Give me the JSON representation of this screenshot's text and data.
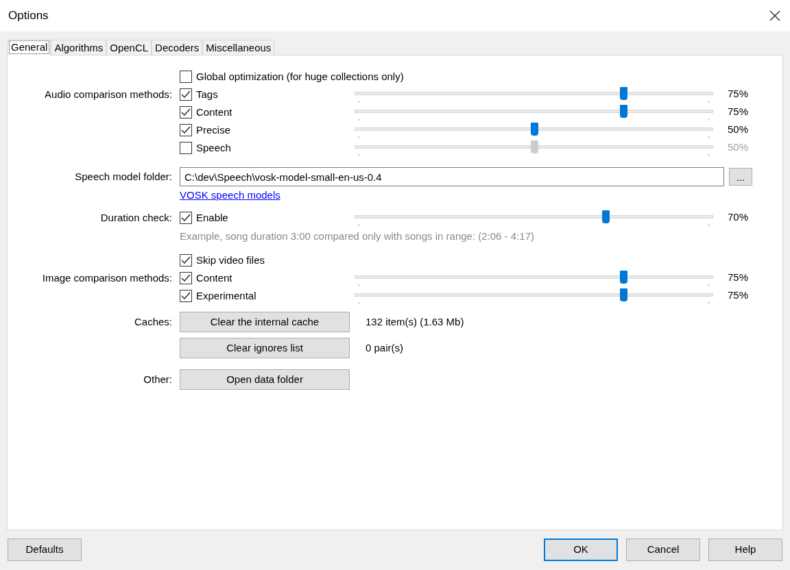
{
  "window": {
    "title": "Options"
  },
  "tabs": [
    {
      "label": "General",
      "selected": true
    },
    {
      "label": "Algorithms",
      "selected": false
    },
    {
      "label": "OpenCL",
      "selected": false
    },
    {
      "label": "Decoders",
      "selected": false
    },
    {
      "label": "Miscellaneous",
      "selected": false
    }
  ],
  "rows": [
    {
      "kind": "checkbox",
      "text": "Global optimization (for huge collections only)",
      "checked": false
    },
    {
      "kind": "slider",
      "label": "Audio comparison methods:",
      "text": "Tags",
      "checked": true,
      "level": 0.75,
      "reading": "75%",
      "disabled": false
    },
    {
      "kind": "slider",
      "text": "Content",
      "checked": true,
      "level": 0.75,
      "reading": "75%",
      "disabled": false
    },
    {
      "kind": "slider",
      "text": "Precise",
      "checked": true,
      "level": 0.5,
      "reading": "50%",
      "disabled": false
    },
    {
      "kind": "slider",
      "text": "Speech",
      "checked": false,
      "level": 0.5,
      "reading": "50%",
      "disabled": true
    },
    {
      "kind": "field",
      "label": "Speech model folder:",
      "value": "C:\\dev\\Speech\\vosk-model-small-en-us-0.4",
      "button": "..."
    },
    {
      "kind": "link",
      "text": "VOSK speech models"
    },
    {
      "kind": "slider",
      "label": "Duration check:",
      "text": "Enable",
      "checked": true,
      "level": 0.7,
      "reading": "70%",
      "disabled": false
    },
    {
      "kind": "note",
      "text": "Example, song duration 3:00 compared only with songs in range: (2:06 - 4:17)"
    },
    {
      "kind": "checkbox",
      "text": "Skip video files",
      "checked": true
    },
    {
      "kind": "slider",
      "label": "Image comparison methods:",
      "text": "Content",
      "checked": true,
      "level": 0.75,
      "reading": "75%",
      "disabled": false
    },
    {
      "kind": "slider",
      "text": "Experimental",
      "checked": true,
      "level": 0.75,
      "reading": "75%",
      "disabled": false
    },
    {
      "kind": "button",
      "label": "Caches:",
      "button": "Clear the internal cache",
      "info": "132 item(s) (1.63 Mb)"
    },
    {
      "kind": "button",
      "button": "Clear ignores list",
      "info": "0 pair(s)"
    },
    {
      "kind": "button",
      "label": "Other:",
      "button": "Open data folder"
    }
  ],
  "footer": {
    "left": [
      {
        "label": "Defaults",
        "default": false
      }
    ],
    "right": [
      {
        "label": "OK",
        "default": true
      },
      {
        "label": "Cancel",
        "default": false
      },
      {
        "label": "Help",
        "default": false
      }
    ]
  }
}
